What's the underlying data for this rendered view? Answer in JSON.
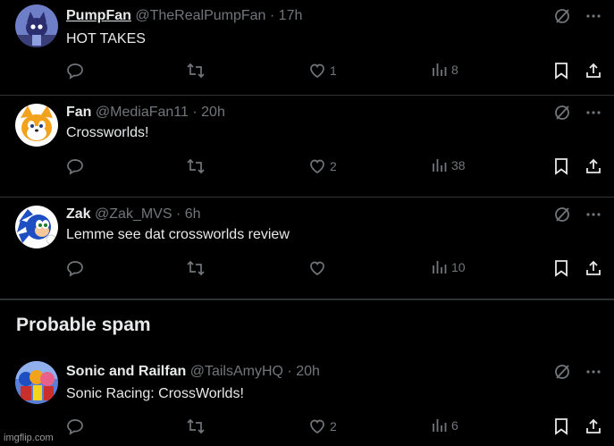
{
  "tweets": [
    {
      "name": "PumpFan",
      "handle": "@TheRealPumpFan",
      "sep": "·",
      "time": "17h",
      "text": "HOT TAKES",
      "likes": "1",
      "views": "8",
      "avatar_icon": "cat-avatar-icon"
    },
    {
      "name": "Fan",
      "handle": "@MediaFan11",
      "sep": "·",
      "time": "20h",
      "text": "Crossworlds!",
      "likes": "2",
      "views": "38",
      "avatar_icon": "fox-avatar-icon"
    },
    {
      "name": "Zak",
      "handle": "@Zak_MVS",
      "sep": "·",
      "time": "6h",
      "text": "Lemme see dat crossworlds review",
      "likes": "",
      "views": "10",
      "avatar_icon": "hedgehog-avatar-icon"
    },
    {
      "name": "Sonic and Railfan",
      "handle": "@TailsAmyHQ",
      "sep": "·",
      "time": "20h",
      "text": "Sonic Racing: CrossWorlds!",
      "likes": "2",
      "views": "6",
      "avatar_icon": "group-avatar-icon"
    }
  ],
  "section": {
    "title": "Probable spam"
  },
  "watermark": "imgflip.com",
  "colors": {
    "background": "#000000",
    "text": "#e7e9ea",
    "muted": "#71767b",
    "divider": "#2f3336"
  }
}
